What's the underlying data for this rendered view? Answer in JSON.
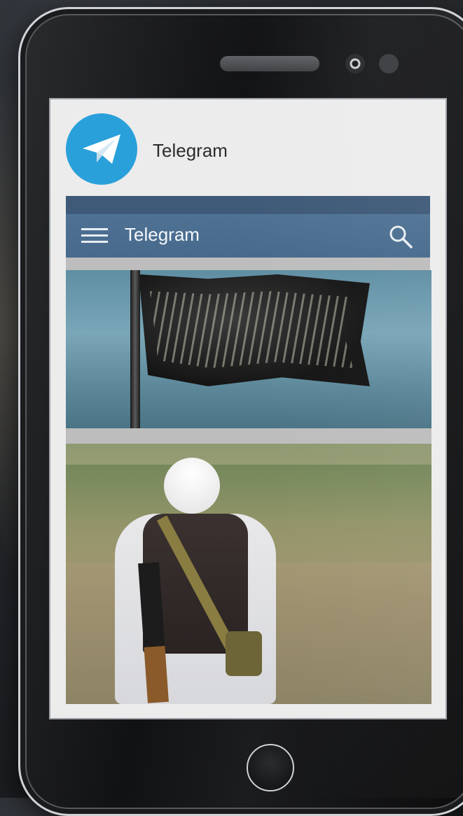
{
  "app_header": {
    "name": "Telegram"
  },
  "navbar": {
    "title": "Telegram"
  },
  "colors": {
    "logo_blue": "#2aa0da",
    "navbar": "#4f7294",
    "topbar_strip": "#3e5a78"
  },
  "icons": {
    "logo": "telegram-paper-plane-icon",
    "menu": "hamburger-menu-icon",
    "search": "search-icon"
  }
}
